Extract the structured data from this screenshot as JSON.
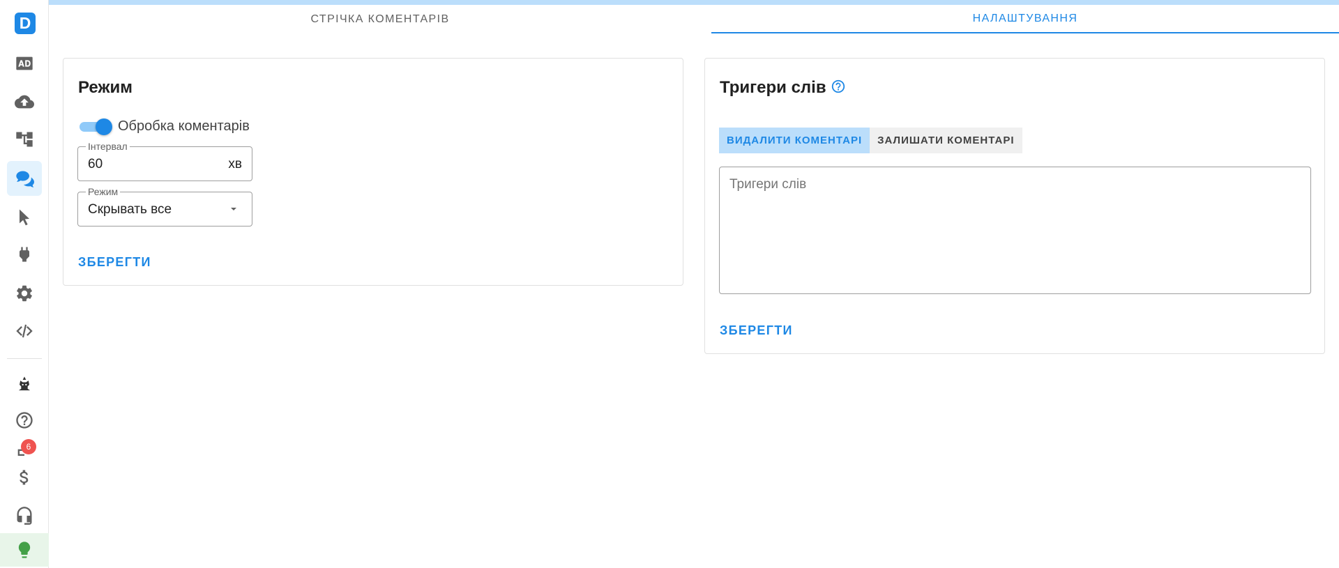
{
  "tabs": [
    {
      "label": "СТРІЧКА КОМЕНТАРІВ",
      "active": false
    },
    {
      "label": "НАЛАШТУВАННЯ",
      "active": true
    }
  ],
  "sidebar": {
    "logo_letter": "D",
    "notification_count": "6",
    "items": [
      {
        "icon": "ad-icon",
        "active": false
      },
      {
        "icon": "cloud-upload-icon",
        "active": false
      },
      {
        "icon": "hierarchy-icon",
        "active": false
      },
      {
        "icon": "comments-icon",
        "active": true
      },
      {
        "icon": "cursor-icon",
        "active": false
      },
      {
        "icon": "plug-icon",
        "active": false
      },
      {
        "icon": "gear-icon",
        "active": false
      },
      {
        "icon": "code-icon",
        "active": false
      },
      {
        "icon": "avatar-icon",
        "active": false
      },
      {
        "icon": "help-icon",
        "active": false
      },
      {
        "icon": "notifications-icon",
        "active": false
      },
      {
        "icon": "dollar-icon",
        "active": false
      },
      {
        "icon": "headset-icon",
        "active": false
      },
      {
        "icon": "lightbulb-icon",
        "active": false
      }
    ]
  },
  "mode_card": {
    "title": "Режим",
    "toggle_label": "Обробка коментарів",
    "toggle_on": true,
    "interval_label": "Інтервал",
    "interval_value": "60",
    "interval_suffix": "хв",
    "mode_label": "Режим",
    "mode_value": "Скрывать все",
    "save_label": "ЗБЕРЕГТИ"
  },
  "triggers_card": {
    "title": "Тригери слів",
    "buttons": [
      {
        "label": "ВИДАЛИТИ КОМЕНТАРІ",
        "active": true
      },
      {
        "label": "ЗАЛИШАТИ КОМЕНТАРІ",
        "active": false
      }
    ],
    "textarea_placeholder": "Тригери слів",
    "save_label": "ЗБЕРЕГТИ"
  },
  "colors": {
    "accent": "#1e88e5",
    "accent_light": "#bbdefb",
    "badge": "#ef5350",
    "bulb": "#43a047"
  }
}
